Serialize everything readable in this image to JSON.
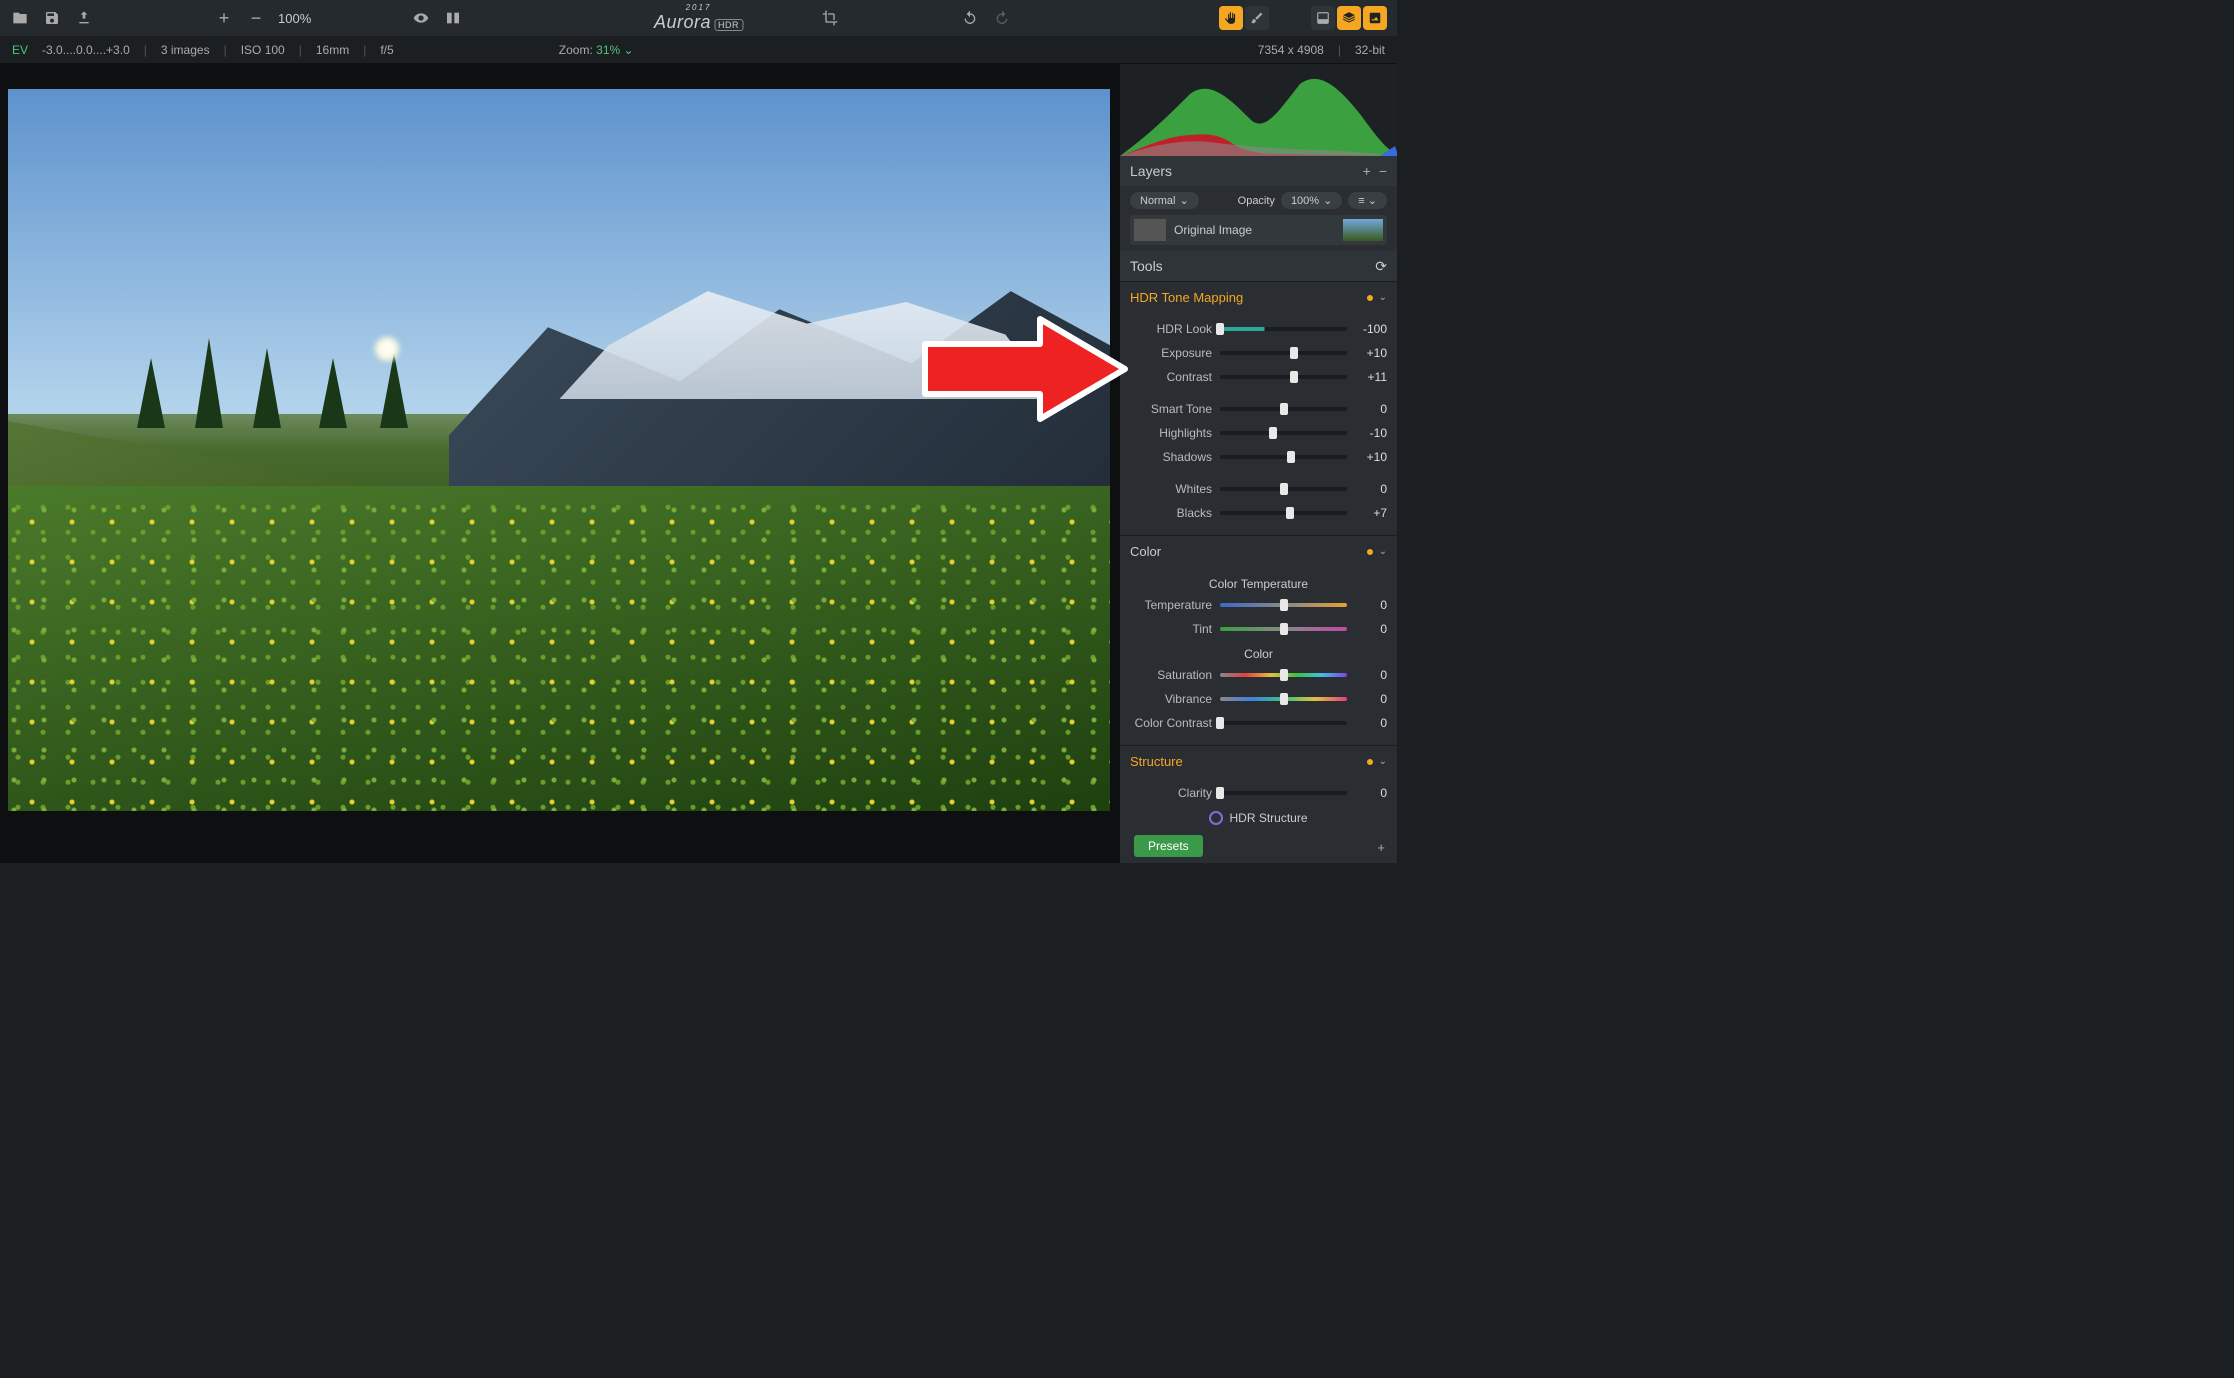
{
  "app": {
    "name": "Aurora",
    "year": "2017",
    "badge": "HDR"
  },
  "topbar": {
    "zoom_pct": "100%"
  },
  "infobar": {
    "ev_label": "EV",
    "ev_values": "-3.0....0.0....+3.0",
    "images": "3 images",
    "iso": "ISO 100",
    "focal": "16mm",
    "aperture": "f/5",
    "zoom_label": "Zoom:",
    "zoom_value": "31%",
    "dimensions": "7354 x 4908",
    "bitdepth": "32-bit"
  },
  "layers": {
    "title": "Layers",
    "blend_mode": "Normal",
    "opacity_label": "Opacity",
    "opacity_value": "100%",
    "layer_name": "Original Image"
  },
  "tools": {
    "title": "Tools",
    "hdr": {
      "title": "HDR Tone Mapping",
      "sliders": [
        {
          "label": "HDR Look",
          "value": "-100",
          "pos": 0,
          "teal": true,
          "fill": 35
        },
        {
          "label": "Exposure",
          "value": "+10",
          "pos": 58
        },
        {
          "label": "Contrast",
          "value": "+11",
          "pos": 58
        },
        {
          "gap": true
        },
        {
          "label": "Smart Tone",
          "value": "0",
          "pos": 50
        },
        {
          "label": "Highlights",
          "value": "-10",
          "pos": 42
        },
        {
          "label": "Shadows",
          "value": "+10",
          "pos": 56
        },
        {
          "gap": true
        },
        {
          "label": "Whites",
          "value": "0",
          "pos": 50
        },
        {
          "label": "Blacks",
          "value": "+7",
          "pos": 55
        }
      ]
    },
    "color": {
      "title": "Color",
      "temp_title": "Color Temperature",
      "color_title": "Color",
      "sliders_temp": [
        {
          "label": "Temperature",
          "value": "0",
          "pos": 50,
          "grad": "temp"
        },
        {
          "label": "Tint",
          "value": "0",
          "pos": 50,
          "grad": "tint"
        }
      ],
      "sliders_color": [
        {
          "label": "Saturation",
          "value": "0",
          "pos": 50,
          "grad": "sat"
        },
        {
          "label": "Vibrance",
          "value": "0",
          "pos": 50,
          "grad": "vib"
        },
        {
          "label": "Color Contrast",
          "value": "0",
          "pos": 0
        }
      ]
    },
    "structure": {
      "title": "Structure",
      "clarity": {
        "label": "Clarity",
        "value": "0",
        "pos": 0
      },
      "hdr_structure": "HDR Structure"
    }
  },
  "presets": {
    "button": "Presets"
  }
}
